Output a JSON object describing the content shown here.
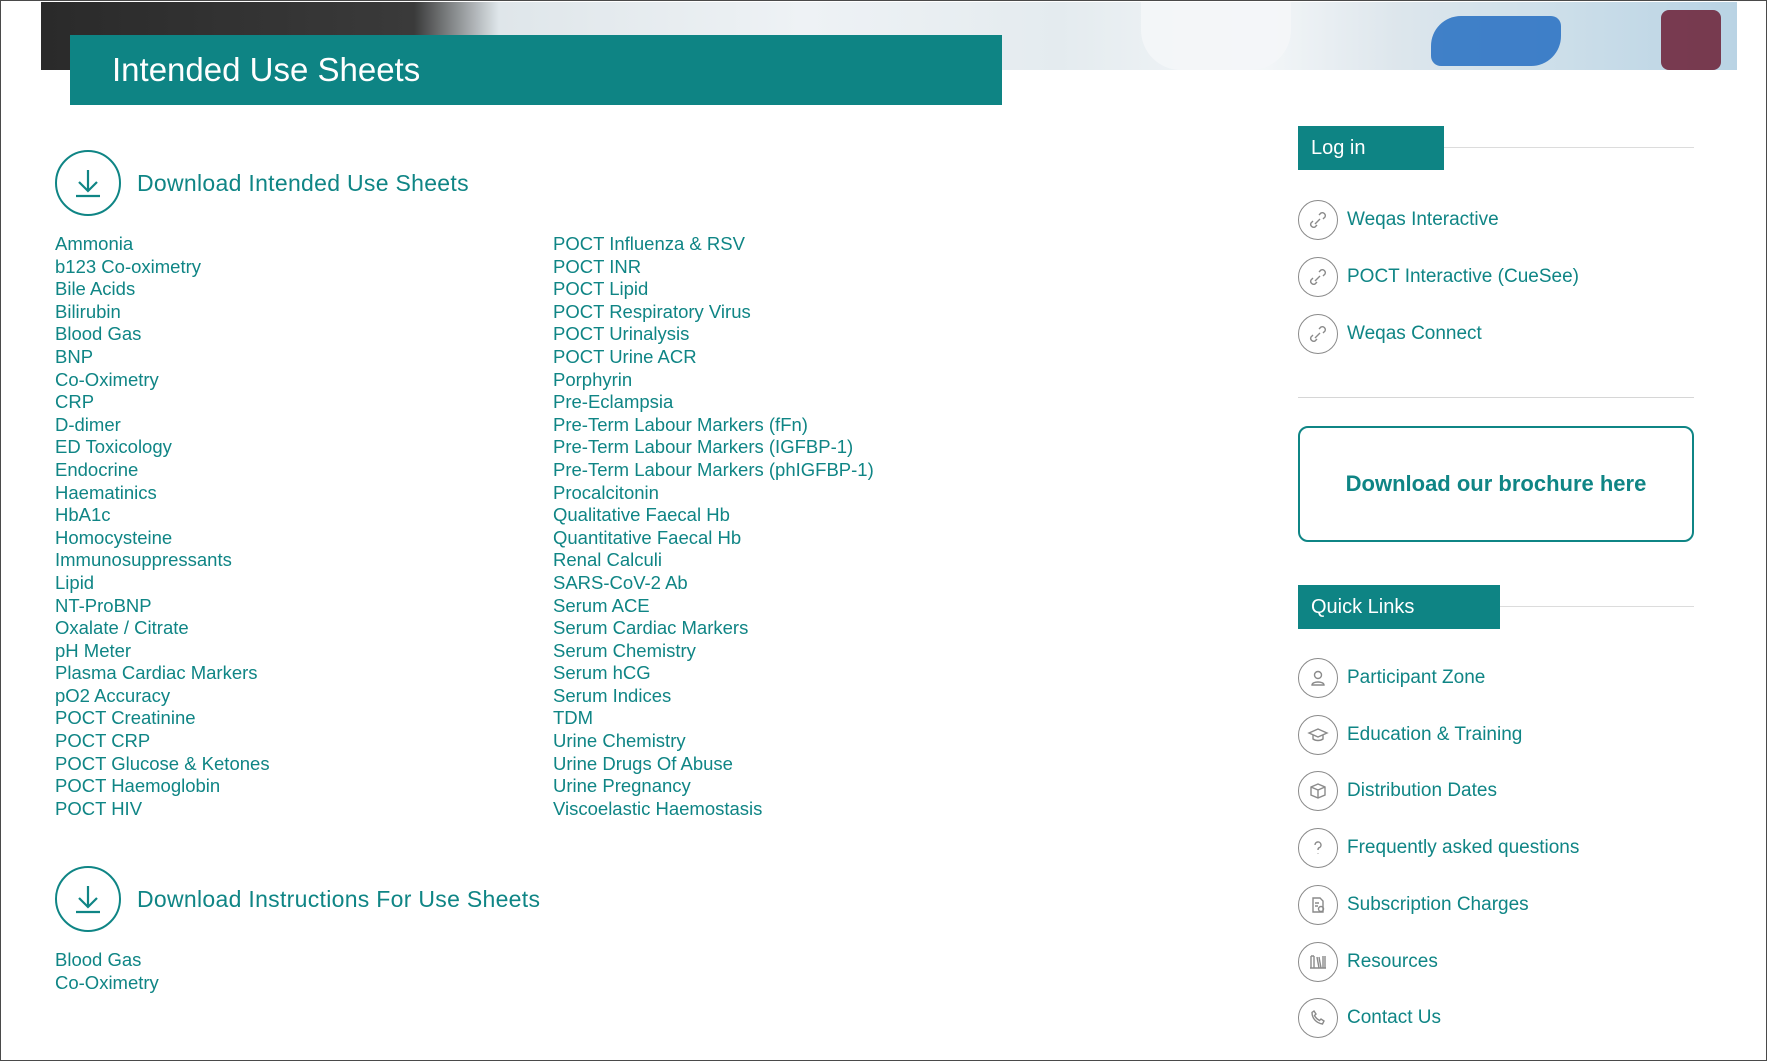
{
  "page_title": "Intended Use Sheets",
  "sections": {
    "intended": {
      "title": "Download Intended Use Sheets",
      "col1": [
        "Ammonia",
        "b123 Co-oximetry",
        "Bile Acids",
        "Bilirubin",
        "Blood Gas",
        "BNP",
        "Co-Oximetry",
        "CRP",
        "D-dimer",
        "ED Toxicology",
        "Endocrine",
        "Haematinics",
        "HbA1c",
        "Homocysteine",
        "Immunosuppressants",
        "Lipid",
        "NT-ProBNP",
        "Oxalate / Citrate",
        "pH Meter",
        "Plasma Cardiac Markers",
        "pO2 Accuracy",
        "POCT Creatinine",
        "POCT CRP",
        "POCT Glucose & Ketones",
        "POCT Haemoglobin",
        "POCT HIV"
      ],
      "col2": [
        "POCT Influenza & RSV",
        "POCT INR",
        "POCT Lipid",
        "POCT Respiratory Virus",
        "POCT Urinalysis",
        "POCT Urine ACR",
        "Porphyrin",
        "Pre-Eclampsia",
        "Pre-Term Labour Markers (fFn)",
        "Pre-Term Labour Markers (IGFBP-1)",
        "Pre-Term Labour Markers (phIGFBP-1)",
        "Procalcitonin",
        "Qualitative Faecal Hb",
        "Quantitative Faecal Hb",
        "Renal Calculi",
        "SARS-CoV-2 Ab",
        "Serum ACE",
        "Serum Cardiac Markers",
        "Serum Chemistry",
        "Serum hCG",
        "Serum Indices",
        "TDM",
        "Urine Chemistry",
        "Urine Drugs Of Abuse",
        "Urine Pregnancy",
        "Viscoelastic Haemostasis"
      ]
    },
    "instructions": {
      "title": "Download Instructions For Use Sheets",
      "items": [
        "Blood Gas",
        "Co-Oximetry"
      ]
    }
  },
  "sidebar": {
    "login": {
      "title": "Log in",
      "links": [
        {
          "label": "Weqas Interactive",
          "icon": "link-icon"
        },
        {
          "label": "POCT Interactive (CueSee)",
          "icon": "link-icon"
        },
        {
          "label": "Weqas Connect",
          "icon": "link-icon"
        }
      ]
    },
    "brochure_label": "Download our brochure here",
    "quick_links": {
      "title": "Quick Links",
      "links": [
        {
          "label": "Participant Zone",
          "icon": "user-icon"
        },
        {
          "label": "Education & Training",
          "icon": "graduation-cap-icon"
        },
        {
          "label": "Distribution Dates",
          "icon": "box-icon"
        },
        {
          "label": "Frequently asked questions",
          "icon": "question-icon"
        },
        {
          "label": "Subscription Charges",
          "icon": "document-icon"
        },
        {
          "label": "Resources",
          "icon": "books-icon"
        },
        {
          "label": "Contact Us",
          "icon": "phone-icon"
        }
      ]
    }
  },
  "colors": {
    "accent": "#0e8484",
    "link": "#0f8585"
  }
}
